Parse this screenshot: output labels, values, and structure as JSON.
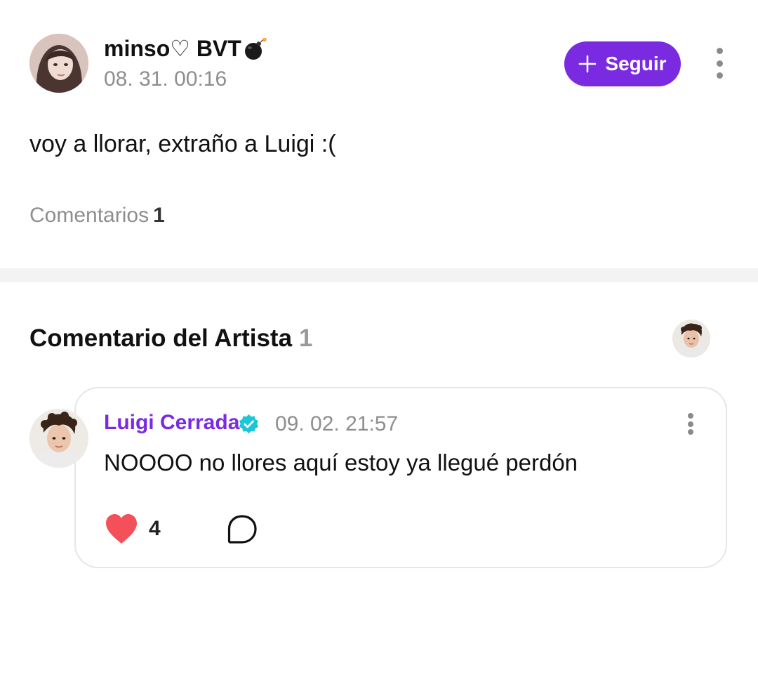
{
  "post": {
    "author_name": "minso♡ BVT",
    "author_emoji_icon": "bomb-icon",
    "date": "08. 31. 00:16",
    "follow_label": "Seguir",
    "text": "voy a llorar, extraño a Luigi :(",
    "comments_label": "Comentarios",
    "comments_count": "1"
  },
  "artist_section": {
    "title": "Comentario del Artista",
    "count": "1",
    "comment": {
      "author_name": "Luigi Cerrada",
      "verified": true,
      "date": "09. 02. 21:57",
      "text": "NOOOO no llores aquí estoy ya llegué perdón",
      "likes": "4",
      "liked": true
    }
  },
  "colors": {
    "accent": "#7a2be2",
    "like_red": "#f4505a",
    "verified_teal": "#1cc6d6",
    "muted_text": "#8e8e8e",
    "divider": "#f3f3f3"
  }
}
